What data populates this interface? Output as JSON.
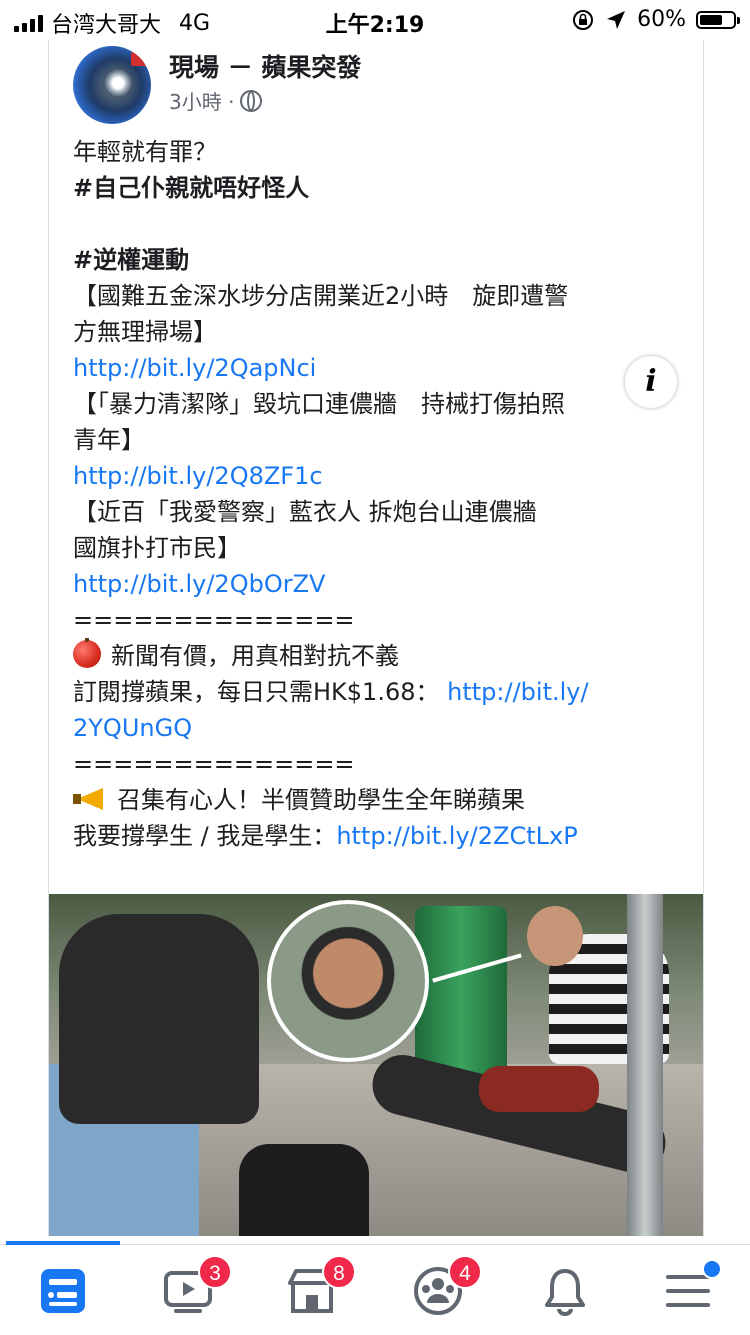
{
  "status_bar": {
    "carrier": "台湾大哥大",
    "network": "4G",
    "time": "上午2:19",
    "battery_percent": "60%",
    "battery_level": 0.6
  },
  "post": {
    "page_name": "現場 － 蘋果突發",
    "time_ago": "3小時 ·",
    "lines": [
      {
        "text": "年輕就有罪？",
        "style": "normal"
      },
      {
        "text": "#自己仆親就唔好怪人",
        "style": "bold"
      },
      {
        "text": "",
        "style": "normal"
      },
      {
        "text": "#逆權運動",
        "style": "bold"
      },
      {
        "text": "【國難五金深水埗分店開業近2小時　旋即遭警",
        "style": "normal"
      },
      {
        "text": "方無理掃場】",
        "style": "normal"
      },
      {
        "text": "http://bit.ly/2QapNci",
        "style": "link"
      },
      {
        "text": "【「暴力清潔隊」毀坑口連儂牆　持械打傷拍照",
        "style": "normal"
      },
      {
        "text": "青年】",
        "style": "normal"
      },
      {
        "text": "http://bit.ly/2Q8ZF1c",
        "style": "link"
      },
      {
        "text": "【近百「我愛警察」藍衣人 拆炮台山連儂牆",
        "style": "normal"
      },
      {
        "text": "國旗扑打市民】",
        "style": "normal"
      },
      {
        "text": "http://bit.ly/2QbOrZV",
        "style": "link"
      },
      {
        "text": "==============",
        "style": "normal"
      }
    ],
    "promo1_text": "新聞有價，用真相對抗不義",
    "promo1_sub": "訂閱撐蘋果，每日只需HK$1.68：",
    "promo1_link_a": "http://bit.ly/",
    "promo1_link_b": "2YQUnGQ",
    "separator2": "==============",
    "promo2_text": "召集有心人！半價贊助學生全年睇蘋果",
    "promo2_sub": "我要撐學生 / 我是學生：",
    "promo2_link": "http://bit.ly/2ZCtLxP",
    "info_label": "i"
  },
  "tab_bar": {
    "tabs": [
      {
        "name": "news-feed",
        "icon": "news-feed-icon",
        "badge": ""
      },
      {
        "name": "watch",
        "icon": "video-icon",
        "badge": "3"
      },
      {
        "name": "marketplace",
        "icon": "marketplace-icon",
        "badge": "8"
      },
      {
        "name": "groups",
        "icon": "groups-icon",
        "badge": "4"
      },
      {
        "name": "notifications",
        "icon": "bell-icon",
        "badge": ""
      },
      {
        "name": "menu",
        "icon": "menu-icon",
        "badge": ""
      }
    ],
    "active_color": "#1877f2",
    "badge_color": "#f02849"
  }
}
